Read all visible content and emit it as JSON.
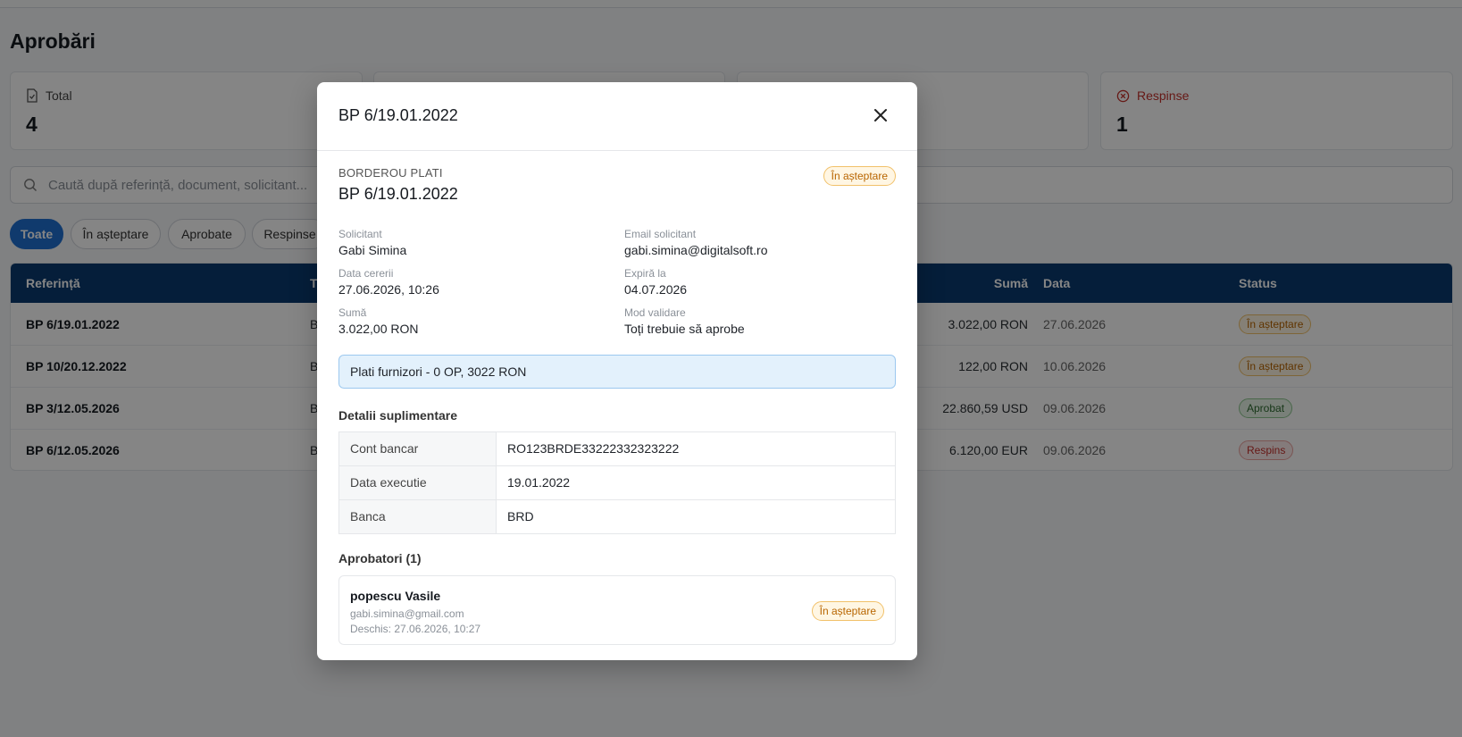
{
  "page": {
    "title": "Aprobări"
  },
  "stats": [
    {
      "label": "Total",
      "value": "4",
      "icon": "document-icon"
    },
    {
      "label": "",
      "value": "",
      "icon": ""
    },
    {
      "label": "",
      "value": "",
      "icon": ""
    },
    {
      "label": "Respinse",
      "value": "1",
      "icon": "x-circle-icon"
    }
  ],
  "search": {
    "placeholder": "Caută după referință, document, solicitant..."
  },
  "filters": [
    "Toate",
    "În așteptare",
    "Aprobate",
    "Respinse"
  ],
  "table": {
    "headers": {
      "ref": "Referință",
      "type": "T",
      "amount": "Sumă",
      "date": "Data",
      "status": "Status"
    },
    "rows": [
      {
        "ref": "BP 6/19.01.2022",
        "type": "B",
        "amount": "3.022,00 RON",
        "date": "27.06.2026",
        "status": "În așteptare",
        "status_kind": "pending"
      },
      {
        "ref": "BP 10/20.12.2022",
        "type": "B",
        "amount": "122,00 RON",
        "date": "10.06.2026",
        "status": "În așteptare",
        "status_kind": "pending"
      },
      {
        "ref": "BP 3/12.05.2026",
        "type": "B",
        "amount": "22.860,59 USD",
        "date": "09.06.2026",
        "status": "Aprobat",
        "status_kind": "approved"
      },
      {
        "ref": "BP 6/12.05.2026",
        "type": "B",
        "amount": "6.120,00 EUR",
        "date": "09.06.2026",
        "status": "Respins",
        "status_kind": "rejected"
      }
    ]
  },
  "modal": {
    "title": "BP 6/19.01.2022",
    "doc_type": "BORDEROU PLATI",
    "doc_ref": "BP 6/19.01.2022",
    "status": "În așteptare",
    "fields": {
      "requester_label": "Solicitant",
      "requester": "Gabi Simina",
      "email_label": "Email solicitant",
      "email": "gabi.simina@digitalsoft.ro",
      "request_date_label": "Data cererii",
      "request_date": "27.06.2026, 10:26",
      "expires_label": "Expiră la",
      "expires": "04.07.2026",
      "amount_label": "Sumă",
      "amount": "3.022,00 RON",
      "validation_label": "Mod validare",
      "validation": "Toți trebuie să aprobe"
    },
    "summary": "Plati furnizori - 0 OP, 3022 RON",
    "details_title": "Detalii suplimentare",
    "details": [
      {
        "key": "Cont bancar",
        "value": "RO123BRDE33222332323222"
      },
      {
        "key": "Data executie",
        "value": "19.01.2022"
      },
      {
        "key": "Banca",
        "value": "BRD"
      }
    ],
    "approvers_title": "Aprobatori (1)",
    "approvers": [
      {
        "name": "popescu Vasile",
        "email": "gabi.simina@gmail.com",
        "opened": "Deschis: 27.06.2026, 10:27",
        "status": "În așteptare"
      }
    ]
  },
  "colors": {
    "primary": "#1f6fd1",
    "header": "#0b3b70",
    "pending": "#b86500",
    "approved": "#2d6a2f",
    "rejected": "#c4302b"
  }
}
